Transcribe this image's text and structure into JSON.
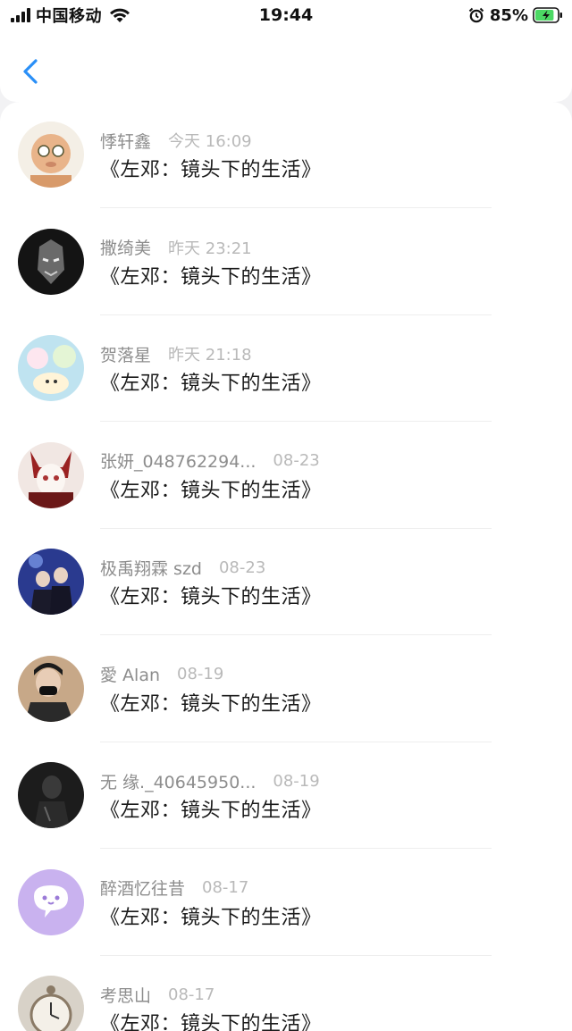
{
  "status": {
    "carrier": "中国移动",
    "time": "19:44",
    "battery_percent": "85%",
    "battery_level": 0.85
  },
  "nav": {
    "back_icon": "chevron-left-icon",
    "accent_color": "#2a8ff7"
  },
  "items": [
    {
      "username": "悸轩鑫",
      "time": "今天 16:09",
      "content": "《左邓：镜头下的生活》",
      "avatar_color": "#e9b48a"
    },
    {
      "username": "撒绮美",
      "time": "昨天 23:21",
      "content": "《左邓：镜头下的生活》",
      "avatar_color": "#141414"
    },
    {
      "username": "贺落星",
      "time": "昨天 21:18",
      "content": "《左邓：镜头下的生活》",
      "avatar_color": "#bfe3f0"
    },
    {
      "username": "张妍_048762294...",
      "time": "08-23",
      "content": "《左邓：镜头下的生活》",
      "avatar_color": "#8a2a2a"
    },
    {
      "username": "极禹翔霖 szd",
      "time": "08-23",
      "content": "《左邓：镜头下的生活》",
      "avatar_color": "#2a3a8f"
    },
    {
      "username": "愛 Alan",
      "time": "08-19",
      "content": "《左邓：镜头下的生活》",
      "avatar_color": "#3b2f2a"
    },
    {
      "username": "无 缘._40645950...",
      "time": "08-19",
      "content": "《左邓：镜头下的生活》",
      "avatar_color": "#1c1c1c"
    },
    {
      "username": "醉酒忆往昔",
      "time": "08-17",
      "content": "《左邓：镜头下的生活》",
      "avatar_color": "#c9b2ef"
    },
    {
      "username": "考思山",
      "time": "08-17",
      "content": "《左邓：镜头下的生活》",
      "avatar_color": "#d8d2c8"
    }
  ]
}
